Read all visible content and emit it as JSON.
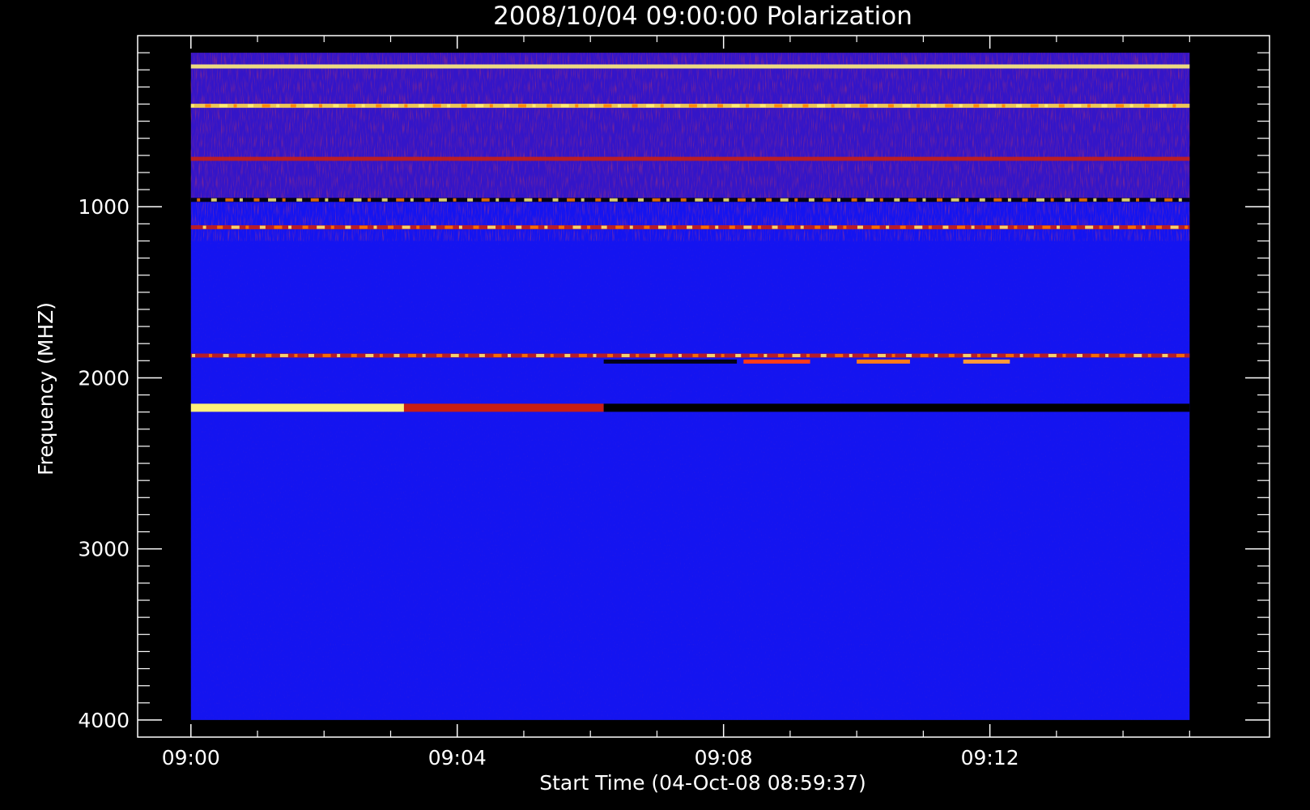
{
  "chart_data": {
    "type": "heatmap",
    "title": "2008/10/04 09:00:00 Polarization",
    "xlabel": "Start Time (04-Oct-08 08:59:37)",
    "ylabel": "Frequency (MHZ)",
    "x_range_minutes": [
      -0.8,
      16.2
    ],
    "data_x_range_minutes": [
      0,
      15
    ],
    "y_range": [
      4100,
      0
    ],
    "data_y_range": [
      4000,
      100
    ],
    "x_ticks": [
      {
        "label": "09:00",
        "minute": 0
      },
      {
        "label": "09:04",
        "minute": 4
      },
      {
        "label": "09:08",
        "minute": 8
      },
      {
        "label": "09:12",
        "minute": 12
      }
    ],
    "y_ticks": [
      {
        "label": "1000",
        "value": 1000
      },
      {
        "label": "2000",
        "value": 2000
      },
      {
        "label": "3000",
        "value": 3000
      },
      {
        "label": "4000",
        "value": 4000
      }
    ],
    "background_color": "#1414f0",
    "colormap": [
      "#000000",
      "#1414f0",
      "#c81e14",
      "#ff7a00",
      "#fff07a",
      "#ffffff"
    ],
    "features": [
      {
        "name": "noisy band",
        "freq_start": 100,
        "freq_end": 950,
        "time_start": 0,
        "time_end": 15,
        "color": "#c81e14"
      },
      {
        "name": "line",
        "freq": 180,
        "time_start": 0,
        "time_end": 15,
        "color": "#fff07a"
      },
      {
        "name": "line",
        "freq": 410,
        "time_start": 0,
        "time_end": 15,
        "color": "#ffd94a"
      },
      {
        "name": "line",
        "freq": 720,
        "time_start": 0,
        "time_end": 15,
        "color": "#c81e14"
      },
      {
        "name": "line",
        "freq": 960,
        "time_start": 0,
        "time_end": 15,
        "color": "#000000"
      },
      {
        "name": "line",
        "freq": 1120,
        "time_start": 0,
        "time_end": 15,
        "color": "#c81e14"
      },
      {
        "name": "line",
        "freq": 1870,
        "time_start": 0,
        "time_end": 15,
        "color": "#c81e14"
      },
      {
        "name": "line",
        "freq": 1905,
        "time_start": 6.2,
        "time_end": 8.2,
        "color": "#000000"
      },
      {
        "name": "burst",
        "freq": 1905,
        "time_start": 8.3,
        "time_end": 9.3,
        "color": "#ff3a1a"
      },
      {
        "name": "burst",
        "freq": 1905,
        "time_start": 10.0,
        "time_end": 10.8,
        "color": "#ff7a1a"
      },
      {
        "name": "burst",
        "freq": 1905,
        "time_start": 11.6,
        "time_end": 12.3,
        "color": "#ff9a3a"
      },
      {
        "name": "strong line",
        "freq": 2175,
        "time_start": 0,
        "time_end": 3.2,
        "color": "#fff07a"
      },
      {
        "name": "fading line",
        "freq": 2175,
        "time_start": 3.2,
        "time_end": 6.2,
        "color": "#c81e14"
      },
      {
        "name": "dark line",
        "freq": 2175,
        "time_start": 6.2,
        "time_end": 15,
        "color": "#000000"
      }
    ]
  }
}
